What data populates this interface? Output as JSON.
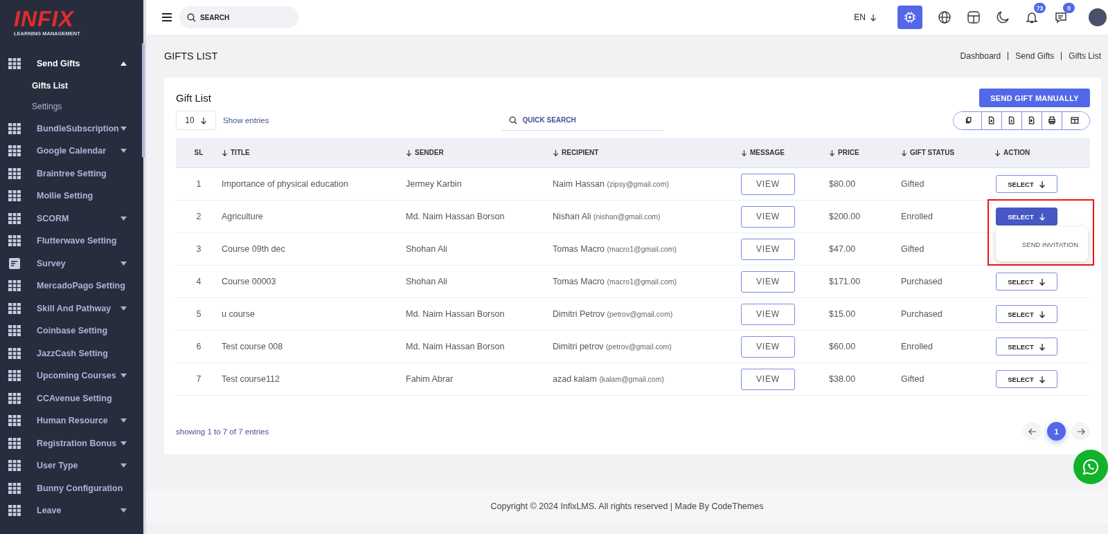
{
  "sidebar": {
    "logo": {
      "brand": "INFIX",
      "tagline": "LEARNING MANAGEMENT"
    },
    "items": [
      {
        "label": "Send Gifts",
        "kind": "grid",
        "has_submenu": true,
        "expanded": true,
        "children": [
          {
            "label": "Gifts List",
            "selected": true
          },
          {
            "label": "Settings",
            "selected": false
          }
        ]
      },
      {
        "label": "BundleSubscription",
        "kind": "grid",
        "has_submenu": true,
        "expanded": false
      },
      {
        "label": "Google Calendar",
        "kind": "grid",
        "has_submenu": true,
        "expanded": false
      },
      {
        "label": "Braintree Setting",
        "kind": "grid",
        "has_submenu": false
      },
      {
        "label": "Mollie Setting",
        "kind": "grid",
        "has_submenu": false
      },
      {
        "label": "SCORM",
        "kind": "grid",
        "has_submenu": true,
        "expanded": false
      },
      {
        "label": "Flutterwave Setting",
        "kind": "grid",
        "has_submenu": false
      },
      {
        "label": "Survey",
        "kind": "list",
        "has_submenu": true,
        "expanded": false
      },
      {
        "label": "MercadoPago Setting",
        "kind": "grid",
        "has_submenu": false
      },
      {
        "label": "Skill And Pathway",
        "kind": "grid",
        "has_submenu": true,
        "expanded": false
      },
      {
        "label": "Coinbase Setting",
        "kind": "grid",
        "has_submenu": false
      },
      {
        "label": "JazzCash Setting",
        "kind": "grid",
        "has_submenu": false
      },
      {
        "label": "Upcoming Courses",
        "kind": "grid",
        "has_submenu": true,
        "expanded": false
      },
      {
        "label": "CCAvenue Setting",
        "kind": "grid",
        "has_submenu": false
      },
      {
        "label": "Human Resource",
        "kind": "grid",
        "has_submenu": true,
        "expanded": false
      },
      {
        "label": "Registration Bonus",
        "kind": "grid",
        "has_submenu": true,
        "expanded": false
      },
      {
        "label": "User Type",
        "kind": "grid",
        "has_submenu": true,
        "expanded": false
      },
      {
        "label": "Bunny Configuration",
        "kind": "grid",
        "has_submenu": false
      },
      {
        "label": "Leave",
        "kind": "grid",
        "has_submenu": true,
        "expanded": false
      }
    ]
  },
  "topbar": {
    "search": {
      "placeholder": "SEARCH"
    },
    "language": "EN",
    "notifications": "73",
    "messages": "0"
  },
  "page_header": {
    "title": "GIFTS LIST",
    "breadcrumb": [
      "Dashboard",
      "Send Gifts",
      "Gifts List"
    ]
  },
  "card": {
    "title": "Gift List",
    "primary_button": "SEND GIFT MANUALLY",
    "page_size": "10",
    "entries_label": "Show entries",
    "search": {
      "placeholder": "QUICK SEARCH"
    },
    "export_tools": [
      {
        "kind": "copy"
      },
      {
        "kind": "excel"
      },
      {
        "kind": "csv"
      },
      {
        "kind": "pdf"
      },
      {
        "kind": "print"
      },
      {
        "kind": "columns"
      }
    ],
    "table": {
      "columns": [
        {
          "label": "SL",
          "sortable": false
        },
        {
          "label": "TITLE",
          "sortable": true
        },
        {
          "label": "SENDER",
          "sortable": true
        },
        {
          "label": "RECIPIENT",
          "sortable": true
        },
        {
          "label": "MESSAGE",
          "sortable": true
        },
        {
          "label": "PRICE",
          "sortable": true
        },
        {
          "label": "GIFT STATUS",
          "sortable": true
        },
        {
          "label": "ACTION",
          "sortable": true
        }
      ],
      "rows": [
        {
          "sl": "1",
          "title": "Importance of physical education",
          "sender": "Jermey Karbin",
          "recipient": "Naim Hassan",
          "email": "(zipsy@gmail.com)",
          "message": "VIEW",
          "price": "$80.00",
          "status": "Gifted",
          "action": "SELECT",
          "menu_open": false
        },
        {
          "sl": "2",
          "title": "Agriculture",
          "sender": "Md. Naim Hassan Borson",
          "recipient": "Nishan Ali",
          "email": "(nishan@gmail.com)",
          "message": "VIEW",
          "price": "$200.00",
          "status": "Enrolled",
          "action": "SELECT",
          "menu_open": true,
          "menu": [
            "SEND INVITATION"
          ]
        },
        {
          "sl": "3",
          "title": "Course 09th dec",
          "sender": "Shohan Ali",
          "recipient": "Tomas Macro",
          "email": "(macro1@gmail.com)",
          "message": "VIEW",
          "price": "$47.00",
          "status": "Gifted",
          "menu_open": false
        },
        {
          "sl": "4",
          "title": "Course 00003",
          "sender": "Shohan Ali",
          "recipient": "Tomas Macro",
          "email": "(macro1@gmail.com)",
          "message": "VIEW",
          "price": "$171.00",
          "status": "Purchased",
          "action": "SELECT",
          "menu_open": false
        },
        {
          "sl": "5",
          "title": "u course",
          "sender": "Md. Naim Hassan Borson",
          "recipient": "Dimitri Petrov",
          "email": "(petrov@gmail.com)",
          "message": "VIEW",
          "price": "$15.00",
          "status": "Purchased",
          "action": "SELECT",
          "menu_open": false
        },
        {
          "sl": "6",
          "title": "Test course 008",
          "sender": "Md. Naim Hassan Borson",
          "recipient": "Dimitri petrov",
          "email": "(petrov@gmail.com)",
          "message": "VIEW",
          "price": "$60.00",
          "status": "Enrolled",
          "action": "SELECT",
          "menu_open": false
        },
        {
          "sl": "7",
          "title": "Test course112",
          "sender": "Fahim Abrar",
          "recipient": "azad kalam",
          "email": "(kalam@gmail.com)",
          "message": "VIEW",
          "price": "$38.00",
          "status": "Gifted",
          "action": "SELECT",
          "menu_open": false
        }
      ]
    },
    "summary": "showing 1 to 7 of 7 entries",
    "pagination": {
      "pages": [
        {
          "label": "1",
          "selected": true
        }
      ]
    }
  },
  "footer": {
    "copyright": "Copyright © 2024 InfixLMS. All rights reserved | Made By CodeThemes"
  }
}
